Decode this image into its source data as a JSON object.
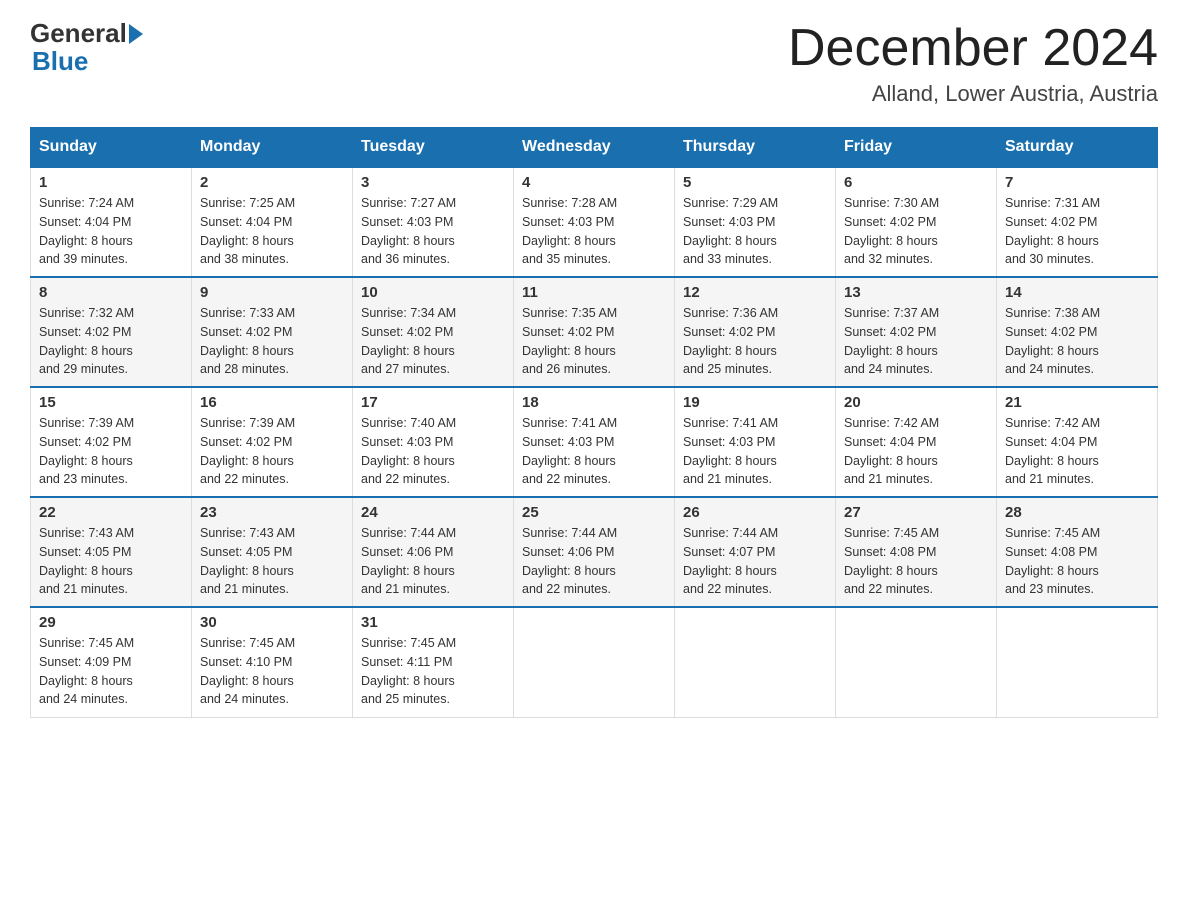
{
  "header": {
    "logo_general": "General",
    "logo_blue": "Blue",
    "month_title": "December 2024",
    "location": "Alland, Lower Austria, Austria"
  },
  "days_of_week": [
    "Sunday",
    "Monday",
    "Tuesday",
    "Wednesday",
    "Thursday",
    "Friday",
    "Saturday"
  ],
  "weeks": [
    [
      {
        "day": "1",
        "sunrise": "7:24 AM",
        "sunset": "4:04 PM",
        "daylight": "8 hours and 39 minutes."
      },
      {
        "day": "2",
        "sunrise": "7:25 AM",
        "sunset": "4:04 PM",
        "daylight": "8 hours and 38 minutes."
      },
      {
        "day": "3",
        "sunrise": "7:27 AM",
        "sunset": "4:03 PM",
        "daylight": "8 hours and 36 minutes."
      },
      {
        "day": "4",
        "sunrise": "7:28 AM",
        "sunset": "4:03 PM",
        "daylight": "8 hours and 35 minutes."
      },
      {
        "day": "5",
        "sunrise": "7:29 AM",
        "sunset": "4:03 PM",
        "daylight": "8 hours and 33 minutes."
      },
      {
        "day": "6",
        "sunrise": "7:30 AM",
        "sunset": "4:02 PM",
        "daylight": "8 hours and 32 minutes."
      },
      {
        "day": "7",
        "sunrise": "7:31 AM",
        "sunset": "4:02 PM",
        "daylight": "8 hours and 30 minutes."
      }
    ],
    [
      {
        "day": "8",
        "sunrise": "7:32 AM",
        "sunset": "4:02 PM",
        "daylight": "8 hours and 29 minutes."
      },
      {
        "day": "9",
        "sunrise": "7:33 AM",
        "sunset": "4:02 PM",
        "daylight": "8 hours and 28 minutes."
      },
      {
        "day": "10",
        "sunrise": "7:34 AM",
        "sunset": "4:02 PM",
        "daylight": "8 hours and 27 minutes."
      },
      {
        "day": "11",
        "sunrise": "7:35 AM",
        "sunset": "4:02 PM",
        "daylight": "8 hours and 26 minutes."
      },
      {
        "day": "12",
        "sunrise": "7:36 AM",
        "sunset": "4:02 PM",
        "daylight": "8 hours and 25 minutes."
      },
      {
        "day": "13",
        "sunrise": "7:37 AM",
        "sunset": "4:02 PM",
        "daylight": "8 hours and 24 minutes."
      },
      {
        "day": "14",
        "sunrise": "7:38 AM",
        "sunset": "4:02 PM",
        "daylight": "8 hours and 24 minutes."
      }
    ],
    [
      {
        "day": "15",
        "sunrise": "7:39 AM",
        "sunset": "4:02 PM",
        "daylight": "8 hours and 23 minutes."
      },
      {
        "day": "16",
        "sunrise": "7:39 AM",
        "sunset": "4:02 PM",
        "daylight": "8 hours and 22 minutes."
      },
      {
        "day": "17",
        "sunrise": "7:40 AM",
        "sunset": "4:03 PM",
        "daylight": "8 hours and 22 minutes."
      },
      {
        "day": "18",
        "sunrise": "7:41 AM",
        "sunset": "4:03 PM",
        "daylight": "8 hours and 22 minutes."
      },
      {
        "day": "19",
        "sunrise": "7:41 AM",
        "sunset": "4:03 PM",
        "daylight": "8 hours and 21 minutes."
      },
      {
        "day": "20",
        "sunrise": "7:42 AM",
        "sunset": "4:04 PM",
        "daylight": "8 hours and 21 minutes."
      },
      {
        "day": "21",
        "sunrise": "7:42 AM",
        "sunset": "4:04 PM",
        "daylight": "8 hours and 21 minutes."
      }
    ],
    [
      {
        "day": "22",
        "sunrise": "7:43 AM",
        "sunset": "4:05 PM",
        "daylight": "8 hours and 21 minutes."
      },
      {
        "day": "23",
        "sunrise": "7:43 AM",
        "sunset": "4:05 PM",
        "daylight": "8 hours and 21 minutes."
      },
      {
        "day": "24",
        "sunrise": "7:44 AM",
        "sunset": "4:06 PM",
        "daylight": "8 hours and 21 minutes."
      },
      {
        "day": "25",
        "sunrise": "7:44 AM",
        "sunset": "4:06 PM",
        "daylight": "8 hours and 22 minutes."
      },
      {
        "day": "26",
        "sunrise": "7:44 AM",
        "sunset": "4:07 PM",
        "daylight": "8 hours and 22 minutes."
      },
      {
        "day": "27",
        "sunrise": "7:45 AM",
        "sunset": "4:08 PM",
        "daylight": "8 hours and 22 minutes."
      },
      {
        "day": "28",
        "sunrise": "7:45 AM",
        "sunset": "4:08 PM",
        "daylight": "8 hours and 23 minutes."
      }
    ],
    [
      {
        "day": "29",
        "sunrise": "7:45 AM",
        "sunset": "4:09 PM",
        "daylight": "8 hours and 24 minutes."
      },
      {
        "day": "30",
        "sunrise": "7:45 AM",
        "sunset": "4:10 PM",
        "daylight": "8 hours and 24 minutes."
      },
      {
        "day": "31",
        "sunrise": "7:45 AM",
        "sunset": "4:11 PM",
        "daylight": "8 hours and 25 minutes."
      },
      null,
      null,
      null,
      null
    ]
  ],
  "labels": {
    "sunrise": "Sunrise:",
    "sunset": "Sunset:",
    "daylight": "Daylight:"
  }
}
